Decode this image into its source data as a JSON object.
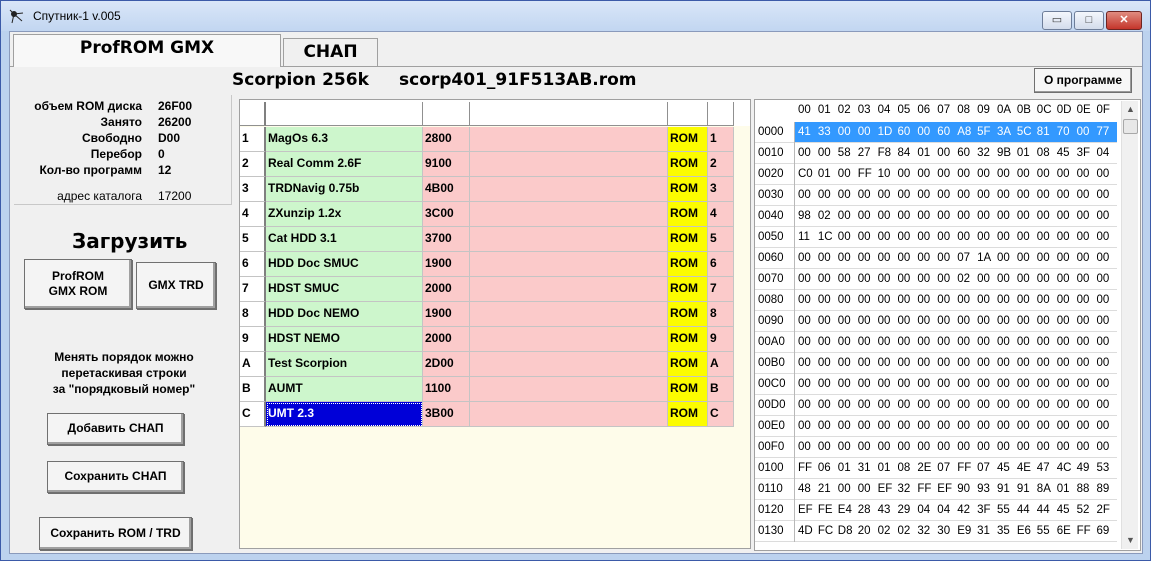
{
  "window": {
    "title": "Спутник-1 v.005",
    "minimize": "▭",
    "maximize": "□",
    "close": "✕"
  },
  "tabs": [
    {
      "label": "ProfROM  GMX"
    },
    {
      "label": "СНАП"
    }
  ],
  "rom": {
    "name": "Scorpion 256k",
    "file": "scorp401_91F513AB.rom"
  },
  "about_button": "О программе",
  "stats": [
    {
      "label": "объем ROM диска",
      "value": "26F00"
    },
    {
      "label": "Занято",
      "value": "26200"
    },
    {
      "label": "Свободно",
      "value": "D00"
    },
    {
      "label": "Перебор",
      "value": "0"
    },
    {
      "label": "Кол-во программ",
      "value": "12"
    }
  ],
  "catalog": {
    "label": "адрес каталога",
    "value": "17200"
  },
  "load": {
    "title": "Загрузить",
    "profrom_line1": "ProfROM",
    "profrom_line2": "GMX ROM",
    "gmx_trd": "GMX TRD"
  },
  "hint": {
    "line1": "Менять порядок можно",
    "line2": "перетаскивая строки",
    "line3": "за \"порядковый номер\""
  },
  "buttons": {
    "add_snap": "Добавить СНАП",
    "save_snap": "Сохранить СНАП",
    "save_rom": "Сохранить ROM / TRD"
  },
  "programs": [
    {
      "idx": "1",
      "name": "MagOs      6.3",
      "size": "2800",
      "type": "ROM",
      "idx2": "1"
    },
    {
      "idx": "2",
      "name": "Real Comm 2.6F",
      "size": "9100",
      "type": "ROM",
      "idx2": "2"
    },
    {
      "idx": "3",
      "name": "TRDNavig 0.75b",
      "size": "4B00",
      "type": "ROM",
      "idx2": "3"
    },
    {
      "idx": "4",
      "name": "ZXunzip   1.2x",
      "size": "3C00",
      "type": "ROM",
      "idx2": "4"
    },
    {
      "idx": "5",
      "name": "Cat HDD    3.1",
      "size": "3700",
      "type": "ROM",
      "idx2": "5"
    },
    {
      "idx": "6",
      "name": "HDD Doc SMUC",
      "size": "1900",
      "type": "ROM",
      "idx2": "6"
    },
    {
      "idx": "7",
      "name": "HDST SMUC",
      "size": "2000",
      "type": "ROM",
      "idx2": "7"
    },
    {
      "idx": "8",
      "name": "HDD Doc NEMO",
      "size": "1900",
      "type": "ROM",
      "idx2": "8"
    },
    {
      "idx": "9",
      "name": "HDST NEMO",
      "size": "2000",
      "type": "ROM",
      "idx2": "9"
    },
    {
      "idx": "A",
      "name": "Test Scorpion",
      "size": "2D00",
      "type": "ROM",
      "idx2": "A"
    },
    {
      "idx": "B",
      "name": "AUMT",
      "size": "1100",
      "type": "ROM",
      "idx2": "B"
    },
    {
      "idx": "C",
      "name": "UMT        2.3",
      "size": "3B00",
      "type": "ROM",
      "idx2": "C"
    }
  ],
  "hex": {
    "columns": [
      "00",
      "01",
      "02",
      "03",
      "04",
      "05",
      "06",
      "07",
      "08",
      "09",
      "0A",
      "0B",
      "0C",
      "0D",
      "0E",
      "0F"
    ],
    "rows": [
      {
        "addr": "0000",
        "bytes": [
          "41",
          "33",
          "00",
          "00",
          "1D",
          "60",
          "00",
          "60",
          "A8",
          "5F",
          "3A",
          "5C",
          "81",
          "70",
          "00",
          "77"
        ]
      },
      {
        "addr": "0010",
        "bytes": [
          "00",
          "00",
          "58",
          "27",
          "F8",
          "84",
          "01",
          "00",
          "60",
          "32",
          "9B",
          "01",
          "08",
          "45",
          "3F",
          "04"
        ]
      },
      {
        "addr": "0020",
        "bytes": [
          "C0",
          "01",
          "00",
          "FF",
          "10",
          "00",
          "00",
          "00",
          "00",
          "00",
          "00",
          "00",
          "00",
          "00",
          "00",
          "00"
        ]
      },
      {
        "addr": "0030",
        "bytes": [
          "00",
          "00",
          "00",
          "00",
          "00",
          "00",
          "00",
          "00",
          "00",
          "00",
          "00",
          "00",
          "00",
          "00",
          "00",
          "00"
        ]
      },
      {
        "addr": "0040",
        "bytes": [
          "98",
          "02",
          "00",
          "00",
          "00",
          "00",
          "00",
          "00",
          "00",
          "00",
          "00",
          "00",
          "00",
          "00",
          "00",
          "00"
        ]
      },
      {
        "addr": "0050",
        "bytes": [
          "11",
          "1C",
          "00",
          "00",
          "00",
          "00",
          "00",
          "00",
          "00",
          "00",
          "00",
          "00",
          "00",
          "00",
          "00",
          "00"
        ]
      },
      {
        "addr": "0060",
        "bytes": [
          "00",
          "00",
          "00",
          "00",
          "00",
          "00",
          "00",
          "00",
          "07",
          "1A",
          "00",
          "00",
          "00",
          "00",
          "00",
          "00"
        ]
      },
      {
        "addr": "0070",
        "bytes": [
          "00",
          "00",
          "00",
          "00",
          "00",
          "00",
          "00",
          "00",
          "02",
          "00",
          "00",
          "00",
          "00",
          "00",
          "00",
          "00"
        ]
      },
      {
        "addr": "0080",
        "bytes": [
          "00",
          "00",
          "00",
          "00",
          "00",
          "00",
          "00",
          "00",
          "00",
          "00",
          "00",
          "00",
          "00",
          "00",
          "00",
          "00"
        ]
      },
      {
        "addr": "0090",
        "bytes": [
          "00",
          "00",
          "00",
          "00",
          "00",
          "00",
          "00",
          "00",
          "00",
          "00",
          "00",
          "00",
          "00",
          "00",
          "00",
          "00"
        ]
      },
      {
        "addr": "00A0",
        "bytes": [
          "00",
          "00",
          "00",
          "00",
          "00",
          "00",
          "00",
          "00",
          "00",
          "00",
          "00",
          "00",
          "00",
          "00",
          "00",
          "00"
        ]
      },
      {
        "addr": "00B0",
        "bytes": [
          "00",
          "00",
          "00",
          "00",
          "00",
          "00",
          "00",
          "00",
          "00",
          "00",
          "00",
          "00",
          "00",
          "00",
          "00",
          "00"
        ]
      },
      {
        "addr": "00C0",
        "bytes": [
          "00",
          "00",
          "00",
          "00",
          "00",
          "00",
          "00",
          "00",
          "00",
          "00",
          "00",
          "00",
          "00",
          "00",
          "00",
          "00"
        ]
      },
      {
        "addr": "00D0",
        "bytes": [
          "00",
          "00",
          "00",
          "00",
          "00",
          "00",
          "00",
          "00",
          "00",
          "00",
          "00",
          "00",
          "00",
          "00",
          "00",
          "00"
        ]
      },
      {
        "addr": "00E0",
        "bytes": [
          "00",
          "00",
          "00",
          "00",
          "00",
          "00",
          "00",
          "00",
          "00",
          "00",
          "00",
          "00",
          "00",
          "00",
          "00",
          "00"
        ]
      },
      {
        "addr": "00F0",
        "bytes": [
          "00",
          "00",
          "00",
          "00",
          "00",
          "00",
          "00",
          "00",
          "00",
          "00",
          "00",
          "00",
          "00",
          "00",
          "00",
          "00"
        ]
      },
      {
        "addr": "0100",
        "bytes": [
          "FF",
          "06",
          "01",
          "31",
          "01",
          "08",
          "2E",
          "07",
          "FF",
          "07",
          "45",
          "4E",
          "47",
          "4C",
          "49",
          "53"
        ]
      },
      {
        "addr": "0110",
        "bytes": [
          "48",
          "21",
          "00",
          "00",
          "EF",
          "32",
          "FF",
          "EF",
          "90",
          "93",
          "91",
          "91",
          "8A",
          "01",
          "88",
          "89"
        ]
      },
      {
        "addr": "0120",
        "bytes": [
          "EF",
          "FE",
          "E4",
          "28",
          "43",
          "29",
          "04",
          "04",
          "42",
          "3F",
          "55",
          "44",
          "44",
          "45",
          "52",
          "2F"
        ]
      },
      {
        "addr": "0130",
        "bytes": [
          "4D",
          "FC",
          "D8",
          "20",
          "02",
          "02",
          "32",
          "30",
          "E9",
          "31",
          "35",
          "E6",
          "55",
          "6E",
          "FF",
          "69"
        ]
      }
    ]
  },
  "colors": {
    "name_bg": "#cdf6cc",
    "size_bg": "#fbcaca",
    "type_bg": "#fcfc00",
    "selection": "#0000d8",
    "hex_selection": "#3399ff"
  }
}
